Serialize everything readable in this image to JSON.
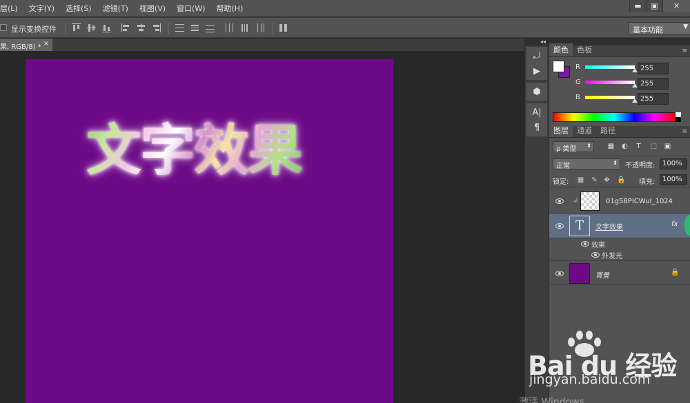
{
  "menubar": {
    "items": [
      "层(L)",
      "文字(Y)",
      "选择(S)",
      "滤镜(T)",
      "视图(V)",
      "窗口(W)",
      "帮助(H)"
    ],
    "window_controls": {
      "minimize": "▬",
      "restore": "▣",
      "close": "✕"
    }
  },
  "options": {
    "show_transform_label": "显示变换控件",
    "workspace": "基本功能"
  },
  "document": {
    "tab_label": "果, RGB/8) *",
    "close_glyph": "×",
    "canvas_text": "文字效果",
    "canvas_color": "#6d0a87"
  },
  "dock": {
    "collapse_glyph": "◂◂"
  },
  "color_panel": {
    "tabs": [
      "颜色",
      "色板"
    ],
    "channels": [
      {
        "label": "R",
        "value": "255"
      },
      {
        "label": "G",
        "value": "255"
      },
      {
        "label": "B",
        "value": "255"
      }
    ],
    "foreground": "#ffffff",
    "background": "#7a1aa0"
  },
  "layers_panel": {
    "tabs": [
      "图层",
      "通道",
      "路径"
    ],
    "filter_kind": "ρ 类型",
    "blend_mode": "正常",
    "opacity_label": "不透明度:",
    "opacity_value": "100%",
    "lock_label": "锁定:",
    "fill_label": "填充:",
    "fill_value": "100%",
    "layers": [
      {
        "name": "01g58PICWuI_1024",
        "type": "image"
      },
      {
        "name": "文字效果",
        "type": "text",
        "fx": "fx",
        "selected": true
      },
      {
        "name": "背景",
        "type": "background"
      }
    ],
    "effects_label": "效果",
    "effect_item": "外发光"
  },
  "watermark": {
    "logo": "Bai du 经验",
    "url": "jingyan.baidu.com",
    "activate": "激活 Windows"
  }
}
